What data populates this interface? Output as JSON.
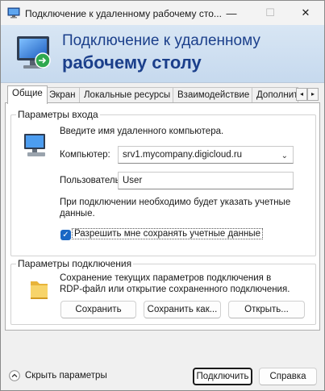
{
  "window": {
    "title": "Подключение к удаленному рабочему сто...",
    "minimize_glyph": "—",
    "maximize_glyph": "☐",
    "close_glyph": "✕"
  },
  "banner": {
    "line1": "Подключение к удаленному",
    "line2": "рабочему столу",
    "logo_icon": "rdp-monitor-icon"
  },
  "tabs": [
    {
      "label": "Общие",
      "active": true
    },
    {
      "label": "Экран",
      "active": false
    },
    {
      "label": "Локальные ресурсы",
      "active": false
    },
    {
      "label": "Взаимодействие",
      "active": false
    },
    {
      "label": "Дополнит",
      "active": false
    }
  ],
  "tab_scroll": {
    "left": "◂",
    "right": "▸"
  },
  "logon": {
    "legend": "Параметры входа",
    "icon": "computer-icon",
    "instruction": "Введите имя удаленного компьютера.",
    "computer_label": "Компьютер:",
    "computer_value": "srv1.mycompany.digicloud.ru",
    "user_label": "Пользователь:",
    "user_value": "User",
    "note_line1": "При подключении необходимо будет указать учетные",
    "note_line2": "данные.",
    "save_credentials_checked": true,
    "save_credentials_label": "Разрешить мне сохранять учетные данные"
  },
  "connection": {
    "legend": "Параметры подключения",
    "icon": "folder-icon",
    "desc_line1": "Сохранение текущих параметров подключения в",
    "desc_line2": "RDP-файл или открытие сохраненного подключения.",
    "save_button": "Сохранить",
    "save_as_button": "Сохранить как...",
    "open_button": "Открыть..."
  },
  "footer": {
    "hide_options": "Скрыть параметры",
    "connect_button": "Подключить",
    "help_button": "Справка"
  },
  "colors": {
    "banner_text": "#1b3f8b",
    "checkbox_accent": "#1a67c4",
    "banner_bg": "#d8e6f4"
  }
}
